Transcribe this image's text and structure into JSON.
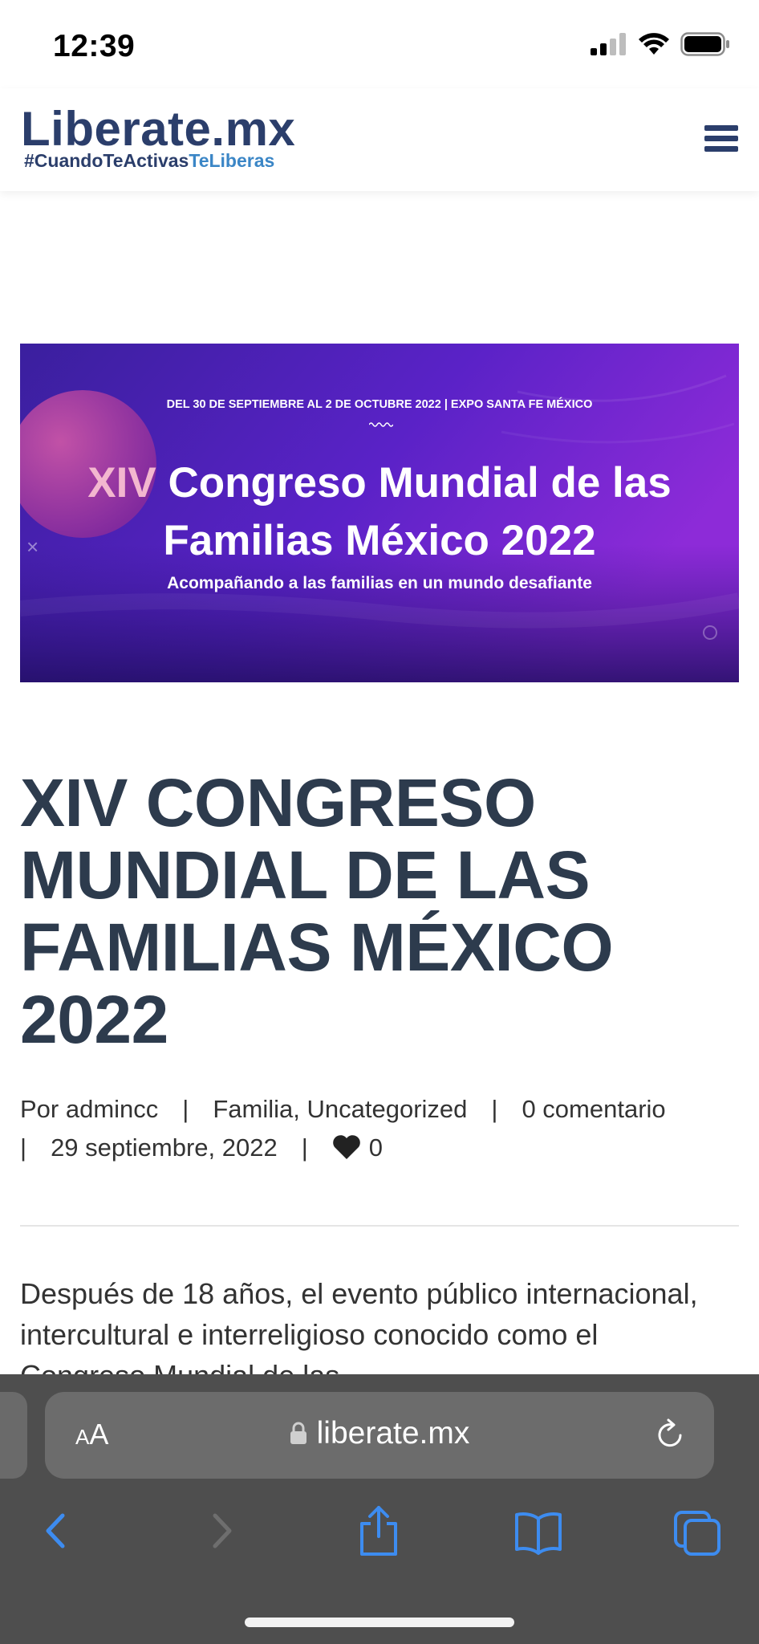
{
  "status_bar": {
    "time": "12:39"
  },
  "header": {
    "logo_text": "Liberate.mx",
    "tagline_part1": "#CuandoTeActivas",
    "tagline_part2": "TeLiberas"
  },
  "hero": {
    "dates": "DEL 30 DE SEPTIEMBRE AL 2 DE OCTUBRE 2022 | EXPO SANTA FE MÉXICO",
    "title_roman": "XIV",
    "title_line1_rest": "Congreso Mundial de las",
    "title_line2": "Familias México 2022",
    "subtitle": "Acompañando a las familias en un mundo desafiante",
    "close_mark": "×"
  },
  "post": {
    "title": "XIV CONGRESO MUNDIAL DE LAS FAMILIAS MÉXICO 2022",
    "author": "Por admincc",
    "categories": "Familia, Uncategorized",
    "comments": "0 comentario",
    "date": "29 septiembre, 2022",
    "likes": "0",
    "separator": "|",
    "excerpt": "Después de 18 años, el evento público internacional, intercultural e interreligioso conocido como el Congreso Mundial de las"
  },
  "browser": {
    "text_size_label_small": "A",
    "text_size_label_large": "A",
    "url": "liberate.mx"
  },
  "colors": {
    "brand": "#2b3e6b",
    "brand_accent": "#3b86c6",
    "title": "#2d3b4d",
    "safari_toolbar": "#4e4e4e",
    "safari_blue": "#3d8cf0"
  },
  "icons": [
    "signal-icon",
    "wifi-icon",
    "battery-icon",
    "hamburger-menu-icon",
    "heart-icon",
    "lock-icon",
    "reload-icon",
    "back-icon",
    "forward-icon",
    "share-icon",
    "bookmarks-icon",
    "tabs-icon"
  ]
}
